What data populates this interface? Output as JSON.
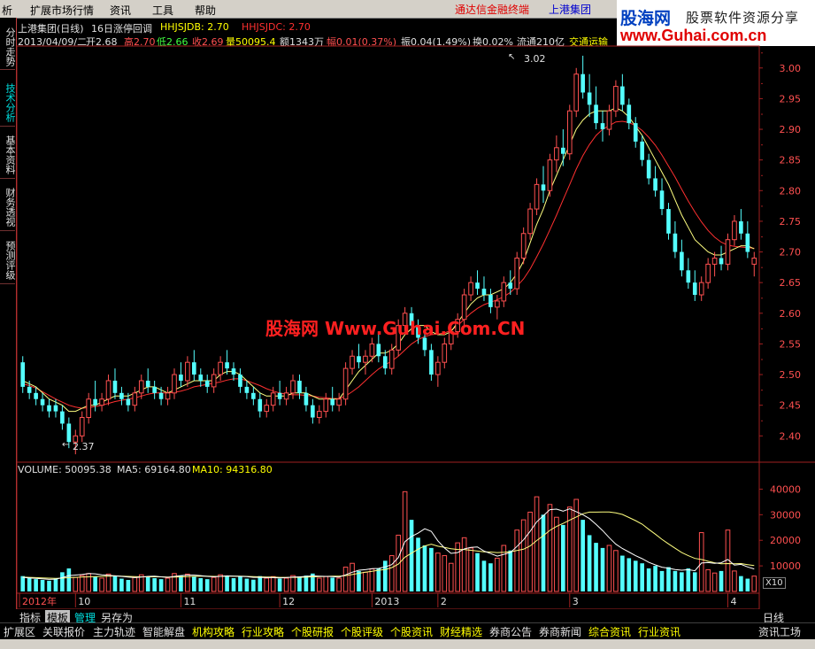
{
  "menu": {
    "items": [
      "析",
      "扩展市场行情",
      "资讯",
      "工具",
      "帮助"
    ],
    "terminal": "通达信金融终端",
    "stock_name": "上港集团"
  },
  "brand": {
    "logo": "股海网",
    "tagline": "股票软件资源分享",
    "url": "www.Guhai.com.cn"
  },
  "left_tabs": [
    "分时走势",
    "技术分析",
    "基本资料",
    "财务透视",
    "预测评级"
  ],
  "header": {
    "title": "上港集团(日线)",
    "indicator": "16日涨停回调",
    "hhjsjdb": "HHJSJDB: 2.70",
    "hhjsjdc": "HHJSJDC: 2.70",
    "date": "2013/04/09/二",
    "open": "开2.68",
    "high": "高2.70",
    "low": "低2.66",
    "close": "收2.69",
    "volume": "量50095.4",
    "amount": "额1343万",
    "change": "幅0.01(0.37%)",
    "amplitude": "振0.04(1.49%)",
    "turnover": "换0.02%",
    "float": "流通210亿",
    "sector": "交通运输"
  },
  "watermark": "股海网 Www.Guhai.Com.CN",
  "annotations": {
    "high": "3.02",
    "low": "2.37"
  },
  "volume_header": {
    "volume": "VOLUME: 50095.38",
    "ma5": "MA5: 69164.80",
    "ma10": "MA10: 94316.80"
  },
  "x_labels": [
    "2012年",
    "10",
    "11",
    "12",
    "2013",
    "2",
    "3",
    "4"
  ],
  "y_price_labels": [
    "3.00",
    "2.95",
    "2.90",
    "2.85",
    "2.80",
    "2.75",
    "2.70",
    "2.65",
    "2.60",
    "2.55",
    "2.50",
    "2.45",
    "2.40"
  ],
  "y_volume_labels": [
    "40000",
    "30000",
    "20000",
    "10000"
  ],
  "x10_label": "X10",
  "period_label": "日线",
  "bottom_tabs": [
    "指标",
    "模板",
    "管理",
    "另存为"
  ],
  "panel_tabs": [
    "扩展区",
    "关联报价",
    "主力轨迹",
    "智能解盘",
    "机构攻略",
    "行业攻略",
    "个股研报",
    "个股评级",
    "个股资讯",
    "财经精选",
    "券商公告",
    "券商新闻",
    "综合资讯",
    "行业资讯",
    "资讯工场"
  ],
  "colors": {
    "up": "#ff5050",
    "down": "#54ffff",
    "ma_yellow": "#ffff80",
    "ma_red": "#ff3030",
    "watermark": "#ff2020",
    "grid": "#a02020",
    "yellow_text": "#ffff00"
  },
  "chart_data": {
    "type": "candlestick",
    "ylim_price": [
      2.36,
      3.03
    ],
    "ylim_volume": [
      0,
      45000
    ],
    "candles": [
      [
        2.52,
        2.53,
        2.47,
        2.48
      ],
      [
        2.48,
        2.49,
        2.46,
        2.47
      ],
      [
        2.47,
        2.48,
        2.45,
        2.46
      ],
      [
        2.46,
        2.47,
        2.44,
        2.45
      ],
      [
        2.45,
        2.46,
        2.43,
        2.44
      ],
      [
        2.45,
        2.46,
        2.43,
        2.44
      ],
      [
        2.44,
        2.45,
        2.41,
        2.42
      ],
      [
        2.42,
        2.43,
        2.38,
        2.39
      ],
      [
        2.39,
        2.41,
        2.37,
        2.4
      ],
      [
        2.4,
        2.44,
        2.39,
        2.43
      ],
      [
        2.43,
        2.47,
        2.42,
        2.46
      ],
      [
        2.46,
        2.49,
        2.44,
        2.45
      ],
      [
        2.45,
        2.47,
        2.44,
        2.46
      ],
      [
        2.46,
        2.5,
        2.45,
        2.49
      ],
      [
        2.49,
        2.51,
        2.46,
        2.47
      ],
      [
        2.47,
        2.48,
        2.45,
        2.46
      ],
      [
        2.46,
        2.47,
        2.44,
        2.45
      ],
      [
        2.45,
        2.48,
        2.44,
        2.47
      ],
      [
        2.47,
        2.5,
        2.46,
        2.49
      ],
      [
        2.49,
        2.51,
        2.47,
        2.48
      ],
      [
        2.48,
        2.49,
        2.46,
        2.47
      ],
      [
        2.47,
        2.48,
        2.45,
        2.46
      ],
      [
        2.46,
        2.48,
        2.45,
        2.47
      ],
      [
        2.47,
        2.51,
        2.46,
        2.5
      ],
      [
        2.5,
        2.52,
        2.48,
        2.49
      ],
      [
        2.49,
        2.53,
        2.48,
        2.52
      ],
      [
        2.52,
        2.54,
        2.49,
        2.5
      ],
      [
        2.5,
        2.51,
        2.48,
        2.49
      ],
      [
        2.49,
        2.5,
        2.47,
        2.48
      ],
      [
        2.48,
        2.51,
        2.47,
        2.5
      ],
      [
        2.5,
        2.53,
        2.49,
        2.52
      ],
      [
        2.52,
        2.54,
        2.5,
        2.51
      ],
      [
        2.51,
        2.52,
        2.49,
        2.5
      ],
      [
        2.5,
        2.51,
        2.47,
        2.48
      ],
      [
        2.48,
        2.49,
        2.46,
        2.47
      ],
      [
        2.47,
        2.48,
        2.45,
        2.46
      ],
      [
        2.46,
        2.47,
        2.43,
        2.44
      ],
      [
        2.44,
        2.46,
        2.43,
        2.45
      ],
      [
        2.45,
        2.48,
        2.44,
        2.47
      ],
      [
        2.47,
        2.49,
        2.45,
        2.46
      ],
      [
        2.46,
        2.48,
        2.45,
        2.47
      ],
      [
        2.47,
        2.5,
        2.46,
        2.49
      ],
      [
        2.49,
        2.5,
        2.46,
        2.47
      ],
      [
        2.47,
        2.48,
        2.44,
        2.45
      ],
      [
        2.45,
        2.46,
        2.42,
        2.43
      ],
      [
        2.43,
        2.45,
        2.42,
        2.44
      ],
      [
        2.44,
        2.47,
        2.43,
        2.46
      ],
      [
        2.46,
        2.48,
        2.44,
        2.45
      ],
      [
        2.45,
        2.47,
        2.44,
        2.46
      ],
      [
        2.46,
        2.52,
        2.45,
        2.51
      ],
      [
        2.51,
        2.54,
        2.5,
        2.53
      ],
      [
        2.53,
        2.55,
        2.51,
        2.52
      ],
      [
        2.52,
        2.54,
        2.5,
        2.53
      ],
      [
        2.53,
        2.56,
        2.52,
        2.55
      ],
      [
        2.55,
        2.57,
        2.52,
        2.53
      ],
      [
        2.53,
        2.54,
        2.5,
        2.51
      ],
      [
        2.51,
        2.55,
        2.5,
        2.54
      ],
      [
        2.54,
        2.59,
        2.53,
        2.58
      ],
      [
        2.58,
        2.61,
        2.57,
        2.6
      ],
      [
        2.6,
        2.61,
        2.57,
        2.58
      ],
      [
        2.58,
        2.59,
        2.55,
        2.56
      ],
      [
        2.56,
        2.57,
        2.53,
        2.54
      ],
      [
        2.54,
        2.55,
        2.49,
        2.5
      ],
      [
        2.5,
        2.53,
        2.48,
        2.52
      ],
      [
        2.52,
        2.56,
        2.51,
        2.55
      ],
      [
        2.55,
        2.58,
        2.54,
        2.57
      ],
      [
        2.57,
        2.6,
        2.56,
        2.59
      ],
      [
        2.59,
        2.64,
        2.58,
        2.63
      ],
      [
        2.63,
        2.66,
        2.62,
        2.65
      ],
      [
        2.65,
        2.67,
        2.63,
        2.64
      ],
      [
        2.64,
        2.66,
        2.62,
        2.63
      ],
      [
        2.63,
        2.64,
        2.6,
        2.61
      ],
      [
        2.61,
        2.63,
        2.59,
        2.62
      ],
      [
        2.62,
        2.66,
        2.61,
        2.65
      ],
      [
        2.65,
        2.67,
        2.63,
        2.64
      ],
      [
        2.64,
        2.7,
        2.63,
        2.69
      ],
      [
        2.69,
        2.74,
        2.68,
        2.73
      ],
      [
        2.73,
        2.78,
        2.72,
        2.77
      ],
      [
        2.77,
        2.82,
        2.76,
        2.81
      ],
      [
        2.81,
        2.84,
        2.78,
        2.8
      ],
      [
        2.8,
        2.86,
        2.79,
        2.85
      ],
      [
        2.85,
        2.89,
        2.83,
        2.87
      ],
      [
        2.87,
        2.9,
        2.84,
        2.86
      ],
      [
        2.86,
        2.94,
        2.85,
        2.93
      ],
      [
        2.93,
        3.0,
        2.92,
        2.99
      ],
      [
        2.99,
        3.02,
        2.95,
        2.96
      ],
      [
        2.96,
        2.99,
        2.92,
        2.94
      ],
      [
        2.94,
        2.97,
        2.9,
        2.91
      ],
      [
        2.91,
        2.93,
        2.88,
        2.9
      ],
      [
        2.9,
        2.94,
        2.89,
        2.93
      ],
      [
        2.93,
        2.98,
        2.92,
        2.97
      ],
      [
        2.97,
        2.99,
        2.93,
        2.94
      ],
      [
        2.94,
        2.95,
        2.9,
        2.91
      ],
      [
        2.91,
        2.92,
        2.87,
        2.88
      ],
      [
        2.88,
        2.89,
        2.84,
        2.85
      ],
      [
        2.85,
        2.86,
        2.81,
        2.82
      ],
      [
        2.82,
        2.84,
        2.79,
        2.8
      ],
      [
        2.8,
        2.82,
        2.76,
        2.77
      ],
      [
        2.77,
        2.78,
        2.72,
        2.73
      ],
      [
        2.73,
        2.75,
        2.69,
        2.7
      ],
      [
        2.7,
        2.72,
        2.66,
        2.67
      ],
      [
        2.67,
        2.69,
        2.64,
        2.65
      ],
      [
        2.65,
        2.67,
        2.62,
        2.63
      ],
      [
        2.63,
        2.66,
        2.62,
        2.65
      ],
      [
        2.65,
        2.69,
        2.64,
        2.68
      ],
      [
        2.68,
        2.7,
        2.66,
        2.69
      ],
      [
        2.69,
        2.71,
        2.67,
        2.68
      ],
      [
        2.68,
        2.73,
        2.67,
        2.72
      ],
      [
        2.72,
        2.76,
        2.71,
        2.75
      ],
      [
        2.75,
        2.77,
        2.72,
        2.73
      ],
      [
        2.73,
        2.75,
        2.69,
        2.7
      ],
      [
        2.68,
        2.7,
        2.66,
        2.69
      ]
    ],
    "volume": [
      6000,
      5200,
      4800,
      4500,
      4200,
      5000,
      7500,
      9000,
      5500,
      6200,
      7000,
      5800,
      5200,
      6800,
      6000,
      5000,
      4500,
      5500,
      6500,
      5800,
      5200,
      4800,
      5200,
      7000,
      6200,
      6800,
      6000,
      5200,
      4800,
      5500,
      6500,
      6000,
      5200,
      5800,
      5000,
      4600,
      6000,
      5200,
      5800,
      5000,
      5200,
      6200,
      5800,
      6200,
      7000,
      5200,
      5800,
      5400,
      5200,
      9500,
      11000,
      8000,
      7500,
      8800,
      9000,
      12000,
      14000,
      22000,
      39000,
      28000,
      21000,
      18000,
      17000,
      15000,
      14000,
      11000,
      19000,
      21000,
      17000,
      15000,
      12000,
      11000,
      13000,
      18000,
      16000,
      24000,
      28000,
      31000,
      37000,
      30000,
      34000,
      29000,
      26000,
      33000,
      36000,
      28000,
      22000,
      19000,
      17000,
      18000,
      16000,
      14000,
      13000,
      12000,
      11000,
      9000,
      10000,
      8000,
      9500,
      8000,
      7500,
      9000,
      7500,
      23000,
      8500,
      7200,
      8000,
      24000,
      8000,
      6000,
      5000,
      6000
    ],
    "ma_short": [
      2.49,
      2.485,
      2.48,
      2.47,
      2.46,
      2.455,
      2.45,
      2.44,
      2.44,
      2.445,
      2.45,
      2.45,
      2.455,
      2.46,
      2.465,
      2.465,
      2.465,
      2.47,
      2.475,
      2.48,
      2.48,
      2.475,
      2.47,
      2.475,
      2.48,
      2.485,
      2.49,
      2.49,
      2.49,
      2.49,
      2.5,
      2.505,
      2.505,
      2.5,
      2.49,
      2.48,
      2.47,
      2.465,
      2.465,
      2.465,
      2.465,
      2.47,
      2.47,
      2.47,
      2.465,
      2.46,
      2.46,
      2.46,
      2.46,
      2.475,
      2.49,
      2.505,
      2.515,
      2.525,
      2.535,
      2.535,
      2.54,
      2.55,
      2.565,
      2.575,
      2.58,
      2.58,
      2.57,
      2.565,
      2.565,
      2.57,
      2.585,
      2.6,
      2.615,
      2.625,
      2.63,
      2.63,
      2.635,
      2.64,
      2.65,
      2.665,
      2.685,
      2.715,
      2.745,
      2.77,
      2.8,
      2.825,
      2.85,
      2.875,
      2.9,
      2.915,
      2.925,
      2.93,
      2.93,
      2.93,
      2.935,
      2.93,
      2.92,
      2.905,
      2.89,
      2.87,
      2.85,
      2.83,
      2.81,
      2.785,
      2.76,
      2.74,
      2.72,
      2.71,
      2.7,
      2.695,
      2.695,
      2.7,
      2.705,
      2.71,
      2.71,
      2.705
    ],
    "ma_long": [
      2.485,
      2.482,
      2.478,
      2.472,
      2.466,
      2.46,
      2.455,
      2.45,
      2.447,
      2.445,
      2.446,
      2.448,
      2.45,
      2.453,
      2.456,
      2.458,
      2.46,
      2.462,
      2.465,
      2.468,
      2.47,
      2.47,
      2.47,
      2.471,
      2.473,
      2.476,
      2.48,
      2.482,
      2.484,
      2.486,
      2.488,
      2.491,
      2.493,
      2.493,
      2.49,
      2.486,
      2.482,
      2.477,
      2.473,
      2.47,
      2.468,
      2.467,
      2.467,
      2.466,
      2.465,
      2.463,
      2.462,
      2.461,
      2.461,
      2.465,
      2.472,
      2.48,
      2.49,
      2.5,
      2.509,
      2.516,
      2.522,
      2.53,
      2.54,
      2.55,
      2.557,
      2.562,
      2.565,
      2.566,
      2.568,
      2.572,
      2.58,
      2.59,
      2.6,
      2.608,
      2.614,
      2.618,
      2.622,
      2.627,
      2.634,
      2.644,
      2.656,
      2.672,
      2.692,
      2.713,
      2.736,
      2.76,
      2.785,
      2.81,
      2.835,
      2.857,
      2.875,
      2.89,
      2.9,
      2.906,
      2.912,
      2.913,
      2.911,
      2.906,
      2.898,
      2.887,
      2.874,
      2.858,
      2.84,
      2.822,
      2.802,
      2.783,
      2.765,
      2.749,
      2.735,
      2.724,
      2.716,
      2.711,
      2.709,
      2.708,
      2.707,
      2.706
    ],
    "vol_ma5": [
      5500,
      5300,
      5100,
      4900,
      4700,
      4800,
      5400,
      6200,
      6400,
      6600,
      7000,
      6900,
      6500,
      6300,
      6100,
      5900,
      5600,
      5400,
      5600,
      5900,
      6000,
      5700,
      5500,
      5900,
      6200,
      6400,
      6400,
      6200,
      5900,
      5700,
      5900,
      6100,
      6000,
      5900,
      5800,
      5500,
      5500,
      5400,
      5400,
      5300,
      5400,
      5600,
      5700,
      5900,
      6100,
      6000,
      5900,
      5800,
      5600,
      6500,
      7500,
      8300,
      8500,
      8900,
      9000,
      9600,
      10500,
      13300,
      19500,
      21500,
      22800,
      24500,
      23500,
      19800,
      17000,
      14900,
      15200,
      16600,
      17200,
      17400,
      15800,
      14800,
      13800,
      14500,
      15200,
      17600,
      20200,
      23500,
      27200,
      29600,
      32000,
      32200,
      31400,
      32300,
      31200,
      30000,
      28500,
      26200,
      23800,
      21000,
      18500,
      16800,
      15400,
      14000,
      12800,
      11400,
      10400,
      9500,
      9100,
      8600,
      8300,
      8500,
      8100,
      11100,
      11300,
      11000,
      11200,
      12500,
      10300,
      10600,
      9600,
      8800
    ],
    "vol_ma10": [
      5600,
      5500,
      5400,
      5300,
      5200,
      5100,
      5200,
      5400,
      5500,
      5600,
      5700,
      5800,
      5900,
      6000,
      6100,
      6000,
      5900,
      5800,
      5700,
      5700,
      5700,
      5700,
      5600,
      5600,
      5700,
      5800,
      5900,
      6000,
      6000,
      5900,
      5900,
      6000,
      6000,
      6000,
      5900,
      5800,
      5700,
      5600,
      5600,
      5500,
      5500,
      5500,
      5500,
      5600,
      5700,
      5800,
      5900,
      6000,
      6000,
      6200,
      6600,
      7100,
      7500,
      7900,
      8300,
      8600,
      9300,
      10700,
      13400,
      15000,
      16500,
      17800,
      18500,
      17700,
      17200,
      16700,
      16400,
      16400,
      16100,
      15800,
      15500,
      15400,
      15200,
      15300,
      15500,
      16000,
      16500,
      17800,
      19900,
      21800,
      23900,
      25400,
      26600,
      27900,
      29100,
      30400,
      31000,
      31000,
      31100,
      31100,
      30700,
      30100,
      28900,
      27700,
      26300,
      24300,
      22400,
      20400,
      18600,
      16900,
      15200,
      14000,
      12900,
      12500,
      11800,
      11200,
      10800,
      10900,
      10800,
      10900,
      10500,
      10100
    ]
  }
}
